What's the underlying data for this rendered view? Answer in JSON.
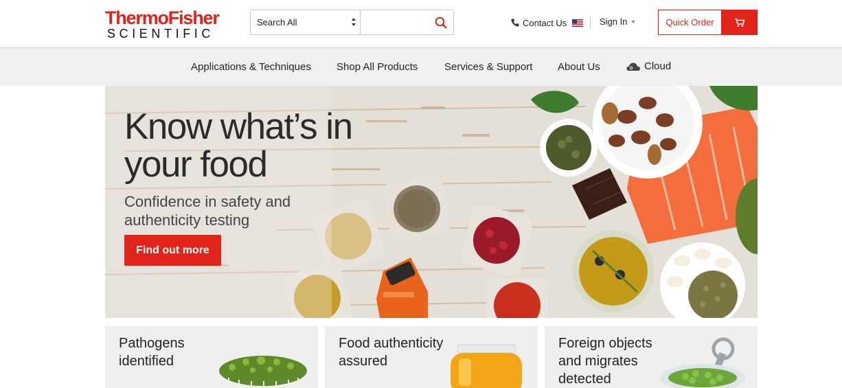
{
  "header": {
    "logo_line1": "ThermoFisher",
    "logo_line2": "SCIENTIFIC",
    "search": {
      "scope_label": "Search All",
      "placeholder": ""
    },
    "contact_label": "Contact Us",
    "signin_label": "Sign In",
    "quick_order_label": "Quick Order",
    "accent_color": "#e2231a"
  },
  "nav": {
    "items": [
      {
        "label": "Applications & Techniques"
      },
      {
        "label": "Shop All Products"
      },
      {
        "label": "Services & Support"
      },
      {
        "label": "About Us"
      },
      {
        "label": "Cloud"
      }
    ]
  },
  "hero": {
    "title_line1": "Know what’s in",
    "title_line2": "your food",
    "subtitle_line1": "Confidence in safety and",
    "subtitle_line2": "authenticity testing",
    "cta_label": "Find out more"
  },
  "cards": [
    {
      "line1": "Pathogens",
      "line2": "identified",
      "image": "sprouts"
    },
    {
      "line1": "Food authenticity",
      "line2": "assured",
      "image": "honey-jar"
    },
    {
      "line1": "Foreign objects",
      "line2": "and migrates",
      "line3": "detected",
      "image": "peas-can"
    }
  ]
}
